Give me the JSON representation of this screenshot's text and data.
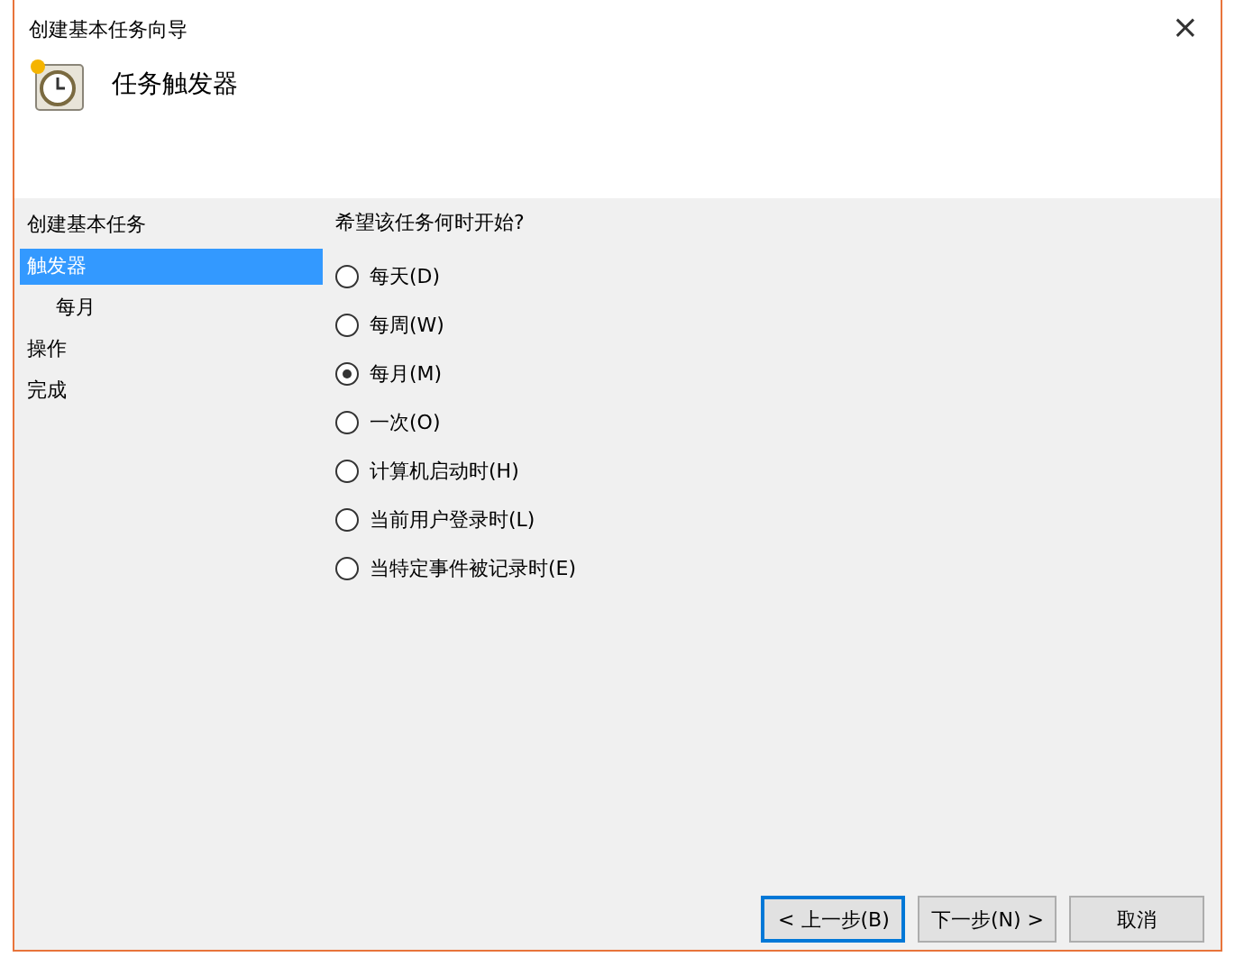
{
  "window": {
    "title": "创建基本任务向导",
    "close": "×"
  },
  "header": {
    "title": "任务触发器"
  },
  "sidebar": {
    "items": [
      {
        "label": "创建基本任务",
        "selected": false
      },
      {
        "label": "触发器",
        "selected": true,
        "children": [
          {
            "label": "每月",
            "selected": false
          }
        ]
      },
      {
        "label": "操作",
        "selected": false
      },
      {
        "label": "完成",
        "selected": false
      }
    ]
  },
  "question": "希望该任务何时开始?",
  "options": [
    {
      "label": "每天(D)",
      "selected": false
    },
    {
      "label": "每周(W)",
      "selected": false
    },
    {
      "label": "每月(M)",
      "selected": true
    },
    {
      "label": "一次(O)",
      "selected": false
    },
    {
      "label": "计算机启动时(H)",
      "selected": false
    },
    {
      "label": "当前用户登录时(L)",
      "selected": false
    },
    {
      "label": "当特定事件被记录时(E)",
      "selected": false
    }
  ],
  "buttons": [
    {
      "label": "< 上一步(B)",
      "focused": true
    },
    {
      "label": "下一步(N) >",
      "focused": false
    },
    {
      "label": "取消",
      "focused": false
    }
  ]
}
